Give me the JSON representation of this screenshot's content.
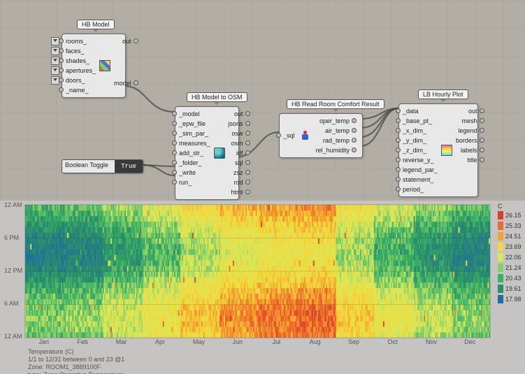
{
  "components": {
    "hb_model": {
      "label": "HB Model",
      "inputs": [
        "rooms_",
        "faces_",
        "shades_",
        "apertures_",
        "doors_",
        "_name_"
      ],
      "outputs": [
        "out",
        "model"
      ]
    },
    "hb_model_to_osm": {
      "label": "HB Model to OSM",
      "inputs": [
        "_model",
        "_epw_file",
        "_sim_par_",
        "measures_",
        "add_str_",
        "_folder_",
        "_write",
        "run_"
      ],
      "outputs": [
        "out",
        "jsons",
        "osw",
        "osm",
        "idf",
        "sql",
        "zsz",
        "rdd",
        "html"
      ]
    },
    "hb_read_comfort": {
      "label": "HB Read Room Comfort Result",
      "inputs": [
        "_sql"
      ],
      "outputs": [
        "oper_temp",
        "air_temp",
        "rad_temp",
        "rel_humidity"
      ]
    },
    "lb_hourly_plot": {
      "label": "LB Hourly Plot",
      "inputs": [
        "_data",
        "_base_pt_",
        "_x_dim_",
        "_y_dim_",
        "_z_dim_",
        "reverse_y_",
        "legend_par_",
        "statement_",
        "period_"
      ],
      "outputs": [
        "out",
        "mesh",
        "legend",
        "borders",
        "labels",
        "title"
      ]
    }
  },
  "toggle": {
    "label": "Boolean Toggle",
    "value": "True"
  },
  "chart_data": {
    "type": "heatmap",
    "title": "Temperature (C)",
    "subtitle1": "1/1 to 12/31 between 0 and 23 @1",
    "subtitle2": "Zone: ROOM1_3889100F",
    "subtitle3": "type: Zone Operative Temperature",
    "xlabel": "",
    "ylabel": "",
    "y_ticks": [
      "12 AM",
      "6 PM",
      "12 PM",
      "6 AM",
      "12 AM"
    ],
    "x_ticks": [
      "Jan",
      "Feb",
      "Mar",
      "Apr",
      "May",
      "Jun",
      "Jul",
      "Aug",
      "Sep",
      "Oct",
      "Nov",
      "Dec"
    ],
    "value_range": [
      17.98,
      26.15
    ],
    "colorbar_unit": "C",
    "colorbar": [
      {
        "value": 26.15,
        "color": "#d9402a"
      },
      {
        "value": 25.33,
        "color": "#ef6a2d"
      },
      {
        "value": 24.51,
        "color": "#f4a32f"
      },
      {
        "value": 23.69,
        "color": "#f4d83c"
      },
      {
        "value": 22.06,
        "color": "#d9e85a"
      },
      {
        "value": 21.24,
        "color": "#86d06a"
      },
      {
        "value": 20.43,
        "color": "#3bb163"
      },
      {
        "value": 19.61,
        "color": "#2c8f6a"
      },
      {
        "value": 17.98,
        "color": "#1e6ea0"
      }
    ],
    "monthly_mean_estimate": [
      20.0,
      20.2,
      21.0,
      21.8,
      22.8,
      23.6,
      24.0,
      24.2,
      22.6,
      21.6,
      20.8,
      20.2
    ]
  }
}
